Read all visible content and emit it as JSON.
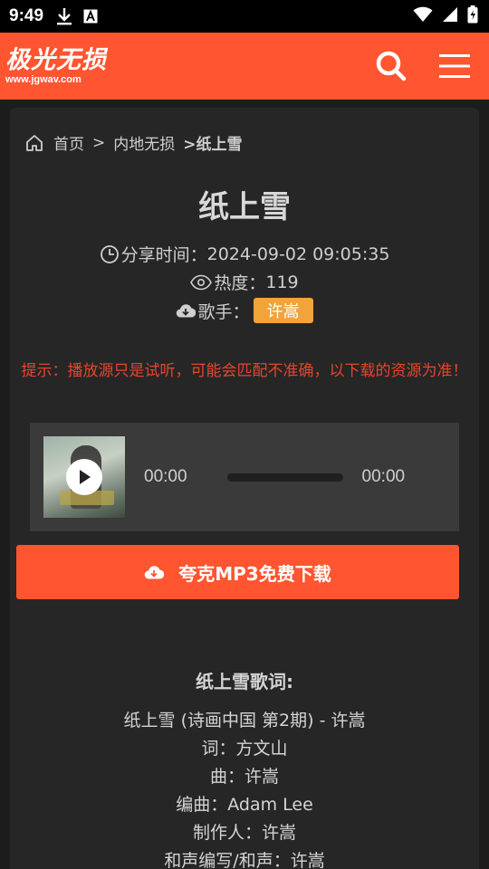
{
  "status_bar": {
    "time": "9:49",
    "icons": [
      "download-icon",
      "text-a-icon",
      "wifi-icon",
      "signal-icon",
      "battery-icon"
    ]
  },
  "header": {
    "logo_text": "极光无损",
    "logo_url": "www.jgwav.com",
    "search_icon": "search-icon",
    "menu_icon": "menu-icon",
    "brand_color": "#ff5530"
  },
  "breadcrumb": {
    "home": "首页",
    "sep1": ">",
    "category": "内地无损",
    "current": ">纸上雪"
  },
  "song": {
    "title": "纸上雪",
    "share_label": "分享时间：",
    "share_time": "2024-09-02 09:05:35",
    "hot_label": "热度：",
    "hot_value": "119",
    "singer_label": "歌手：",
    "singer": "许嵩"
  },
  "notice": "提示：播放源只是试听，可能会匹配不准确，以下载的资源为准！",
  "player": {
    "current_time": "00:00",
    "duration": "00:00",
    "progress": 0
  },
  "download_button": "夸克MP3免费下载",
  "lyrics": {
    "title": "纸上雪歌词:",
    "lines": [
      "纸上雪 (诗画中国 第2期) - 许嵩",
      "词：方文山",
      "曲：许嵩",
      "编曲：Adam Lee",
      "制作人：许嵩",
      "和声编写/和声：许嵩"
    ]
  }
}
